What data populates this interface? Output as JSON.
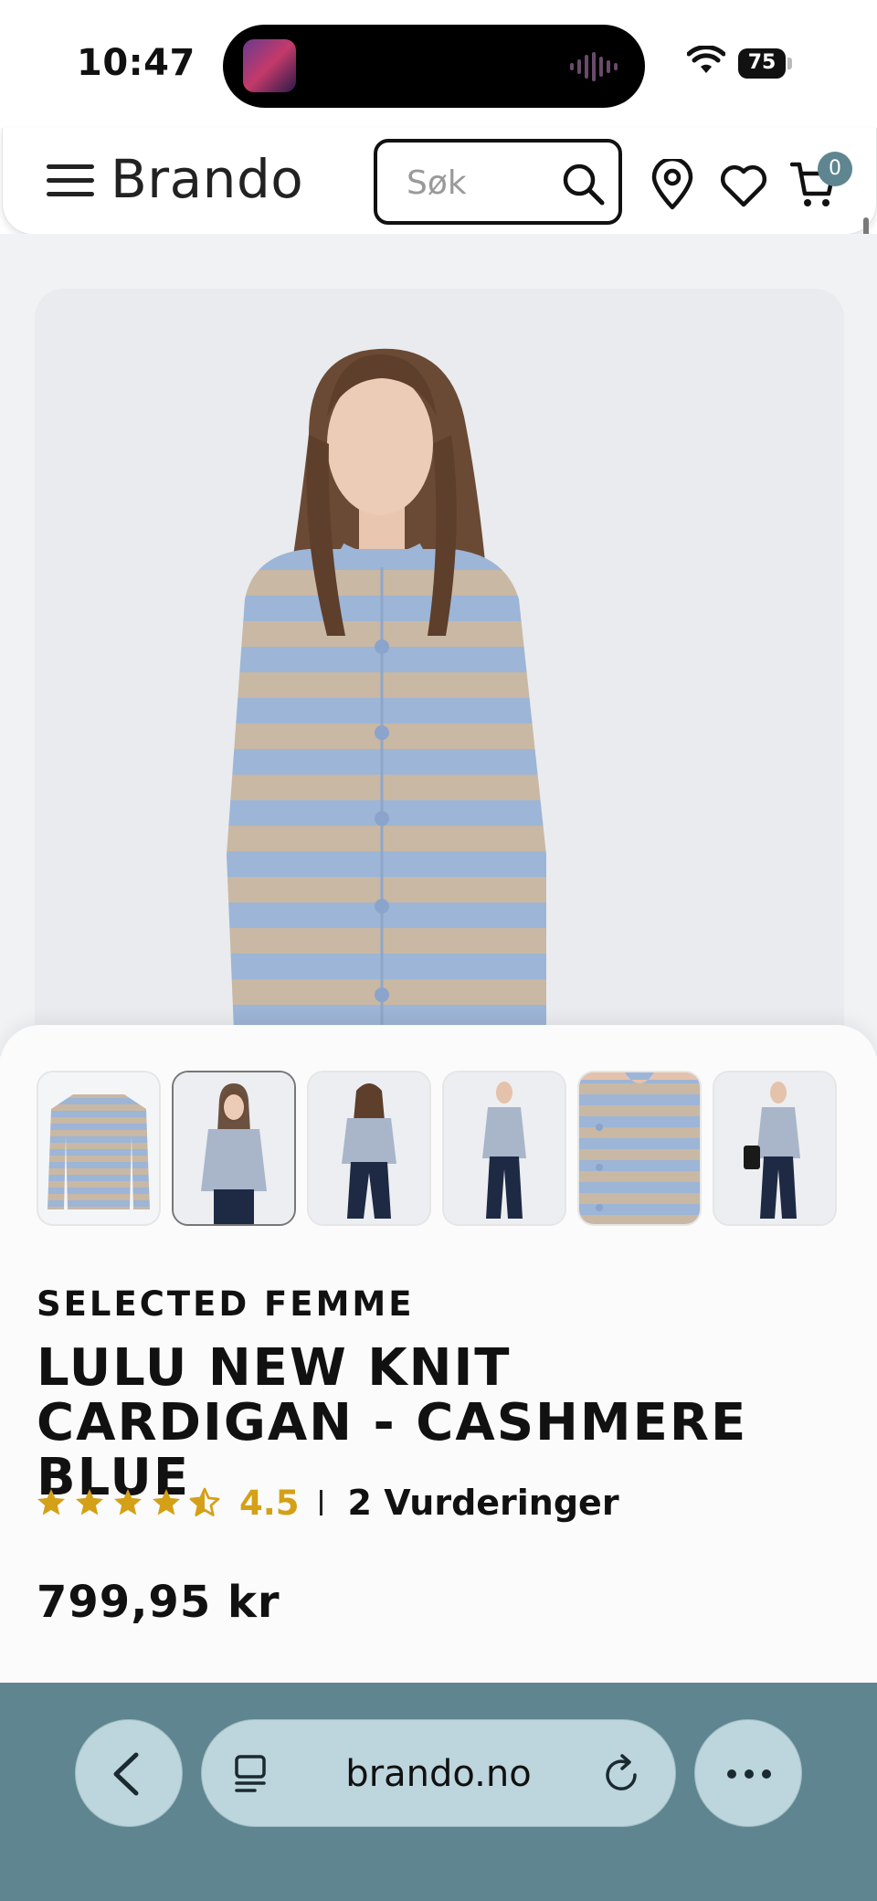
{
  "status_bar": {
    "time": "10:47",
    "battery": "75",
    "island_app_label": "VOICE"
  },
  "header": {
    "brand": "Brando",
    "search_placeholder": "Søk",
    "cart_count": "0"
  },
  "product": {
    "brand": "SELECTED FEMME",
    "title": "LULU NEW KNIT CARDIGAN - CASHMERE BLUE",
    "rating_value": "4.5",
    "rating_fraction": 0.9,
    "reviews": "2 Vurderinger",
    "price": "799,95 kr",
    "thumbnail_count": 6,
    "active_thumbnail": 2
  },
  "browser": {
    "url": "brando.no"
  },
  "colors": {
    "accent": "#5f8690",
    "star": "#d4a017",
    "stripe_blue": "#9db5d6",
    "stripe_beige": "#c9b8a3",
    "toolbar": "#5e8590"
  }
}
